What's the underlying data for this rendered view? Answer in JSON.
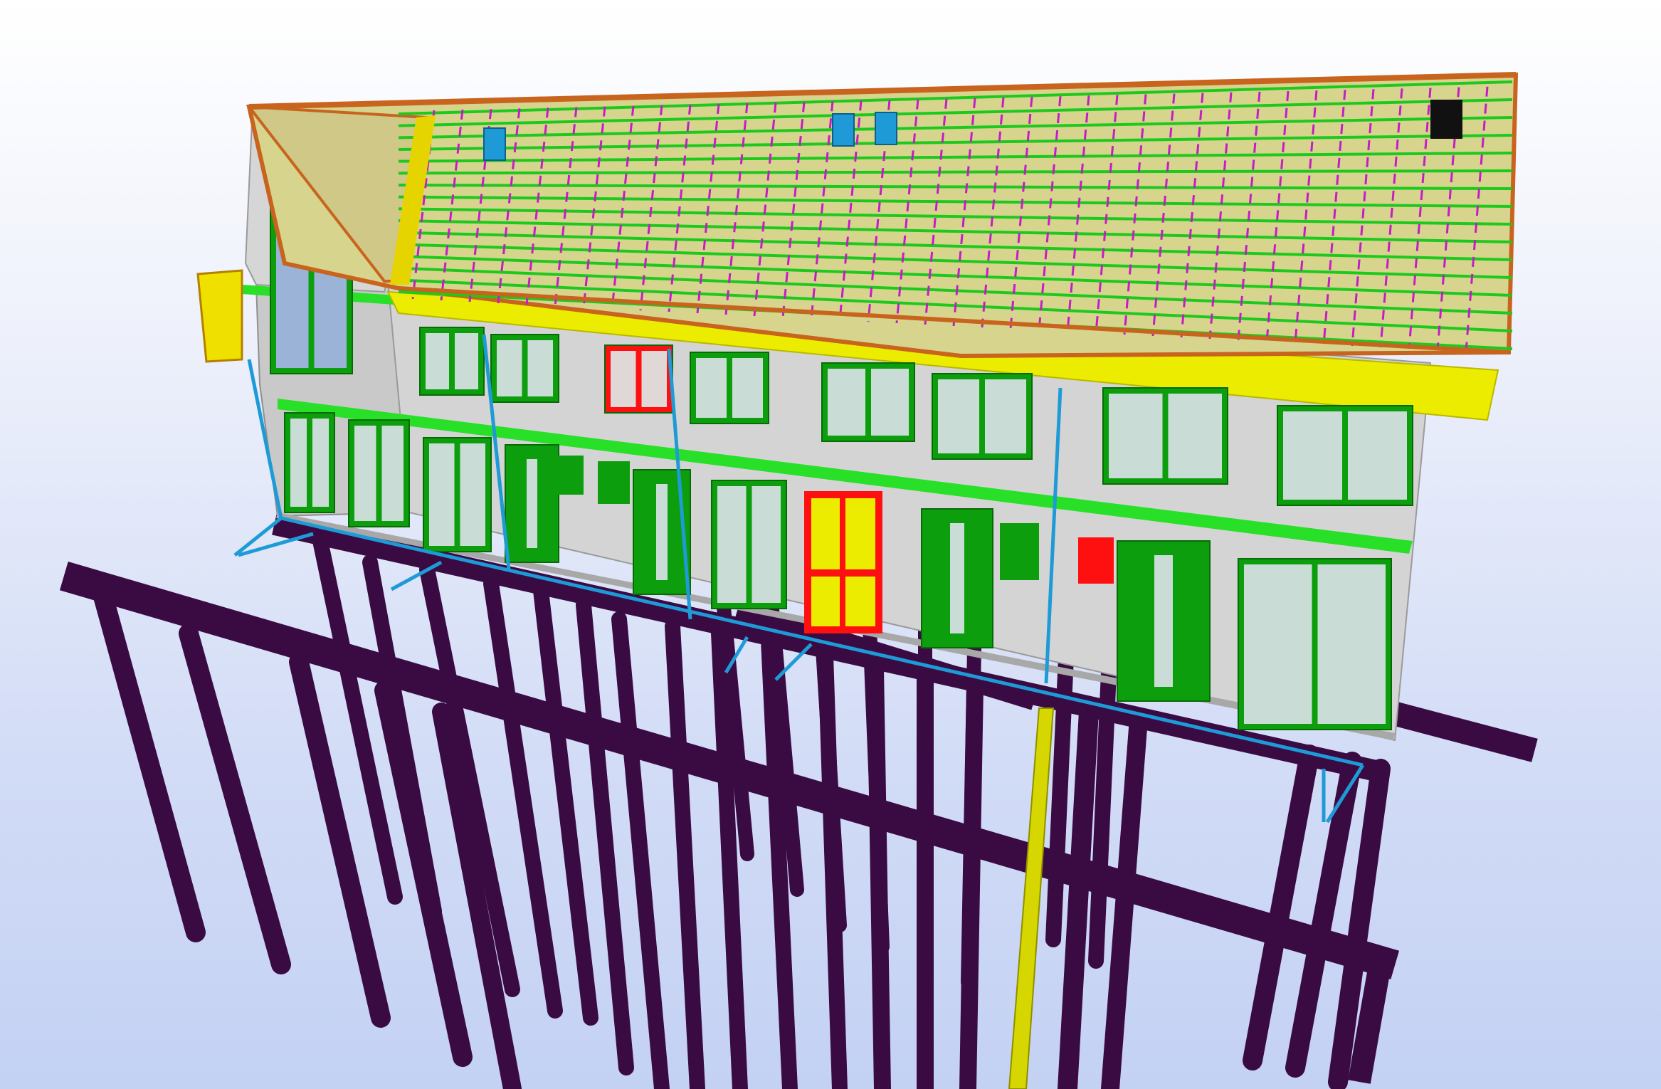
{
  "viewport": {
    "background_top": "#ffffff",
    "background_bottom": "#c3d1f3"
  },
  "model": {
    "colors": {
      "pile": "#3a0b43",
      "beam": "#3a0b43",
      "roof_surface": "#d7d48e",
      "roof_batten": "#1ec91e",
      "roof_rafter": "#c21fc2",
      "roof_edge": "#c8641e",
      "wall": "#d3d3d3",
      "wall_side": "#c7c7c7",
      "floor_band": "#28e028",
      "window_frame": "#0d9e0d",
      "glass": "#c9ddd6",
      "highlight_red": "#ff1010",
      "highlight_yellow": "#ecec00",
      "pipe": "#1e9bd7",
      "gas_pipe": "#d6d600",
      "roof_vent": "#1e9bd7",
      "roof_hatch": "#111111"
    },
    "icons": {
      "roof_vent": "vent-icon",
      "roof_hatch": "roof-hatch-icon"
    }
  }
}
